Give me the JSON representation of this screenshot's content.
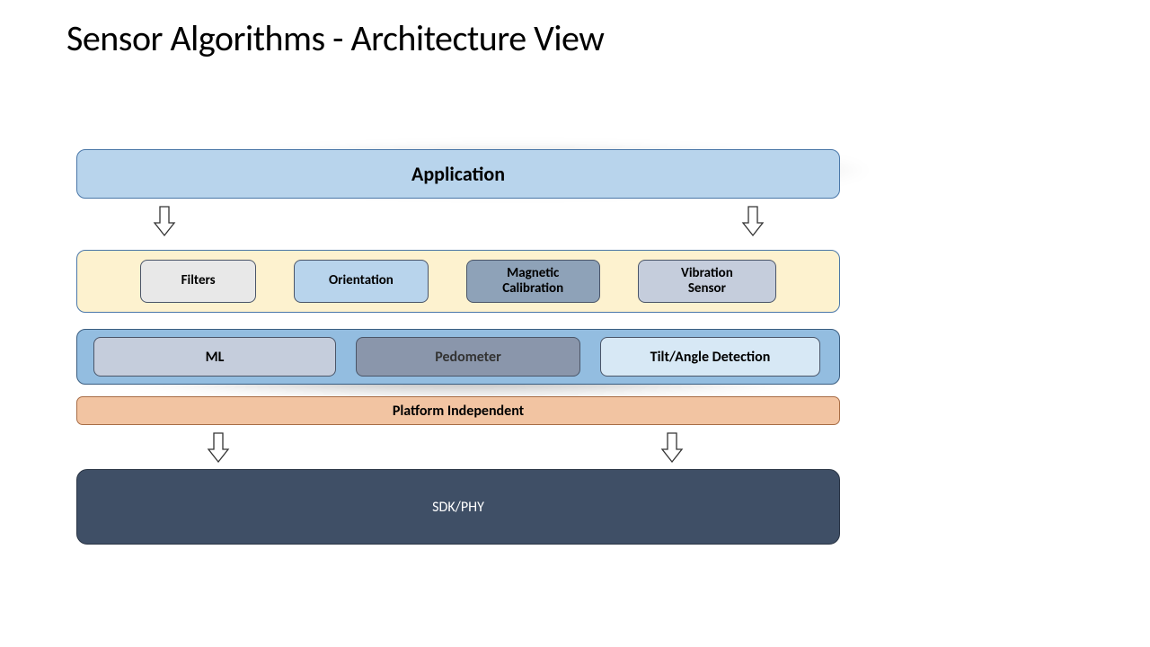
{
  "title": "Sensor Algorithms - Architecture View",
  "layers": {
    "application": "Application",
    "row2": {
      "filters": "Filters",
      "orientation": "Orientation",
      "magnetic": "Magnetic Calibration",
      "vibration": "Vibration Sensor"
    },
    "row3": {
      "ml": "ML",
      "pedometer": "Pedometer",
      "tilt": "Tilt/Angle Detection"
    },
    "platform": "Platform Independent",
    "sdk": "SDK/PHY"
  }
}
